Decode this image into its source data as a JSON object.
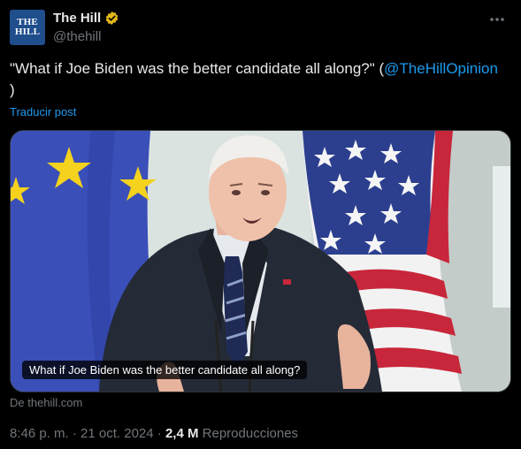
{
  "author": {
    "avatar_lines": [
      "THE",
      "HILL"
    ],
    "display_name": "The Hill",
    "handle": "@thehill",
    "verified_icon": "verified-gold-badge-icon"
  },
  "post": {
    "text_before": "\"What if Joe Biden was the better candidate all along?\" (",
    "mention": "@TheHillOpinion",
    "text_after": ")",
    "translate_label": "Traducir post"
  },
  "media": {
    "caption": "What if Joe Biden was the better candidate all along?",
    "source": "De thehill.com"
  },
  "meta": {
    "time": "8:46 p. m.",
    "separator": "·",
    "date": "21 oct. 2024",
    "views_count": "2,4 M",
    "views_label": "Reproducciones"
  },
  "icons": {
    "more": "more-options-icon"
  },
  "colors": {
    "background": "#000000",
    "text": "#e7e9ea",
    "secondary": "#71767b",
    "link": "#1d9bf0",
    "verified": "#e2b719",
    "avatar_bg": "#1f4e8c"
  }
}
